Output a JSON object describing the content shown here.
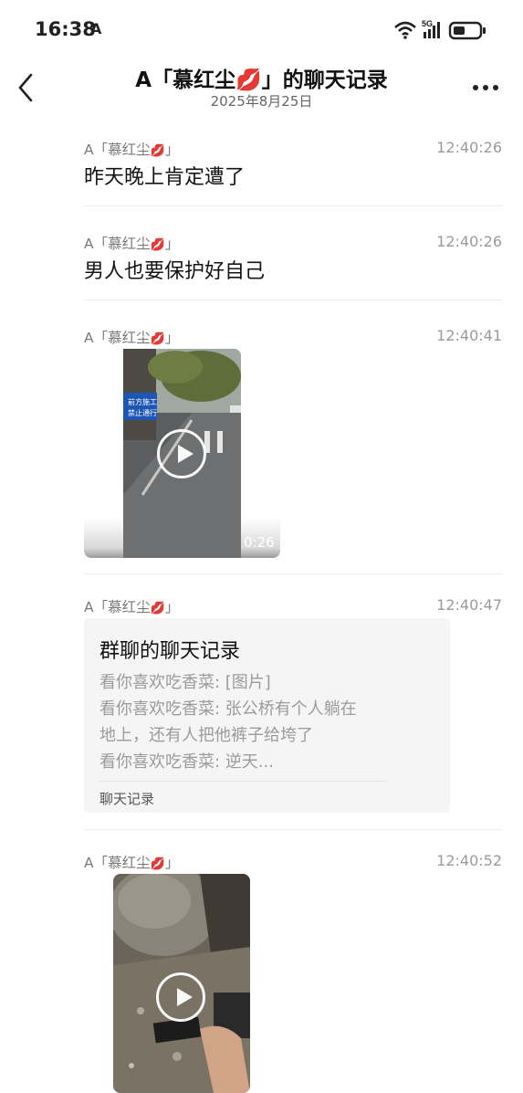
{
  "status": {
    "time": "16:38",
    "app_glyph": "A",
    "network": "5G"
  },
  "header": {
    "title": "A「慕红尘💋」的聊天记录",
    "date": "2025年8月25日"
  },
  "messages": [
    {
      "sender": "A「慕红尘",
      "emoji": "💋",
      "close": "」",
      "time": "12:40:26",
      "text": "昨天晚上肯定遭了"
    },
    {
      "sender": "A「慕红尘",
      "emoji": "💋",
      "close": "」",
      "time": "12:40:26",
      "text": "男人也要保护好自己"
    },
    {
      "sender": "A「慕红尘",
      "emoji": "💋",
      "close": "」",
      "time": "12:40:41",
      "video_duration": "0:26",
      "sign_line1": "前方施工",
      "sign_line2": "禁止通行"
    },
    {
      "sender": "A「慕红尘",
      "emoji": "💋",
      "close": "」",
      "time": "12:40:47",
      "card": {
        "title": "群聊的聊天记录",
        "lines": [
          "看你喜欢吃香菜: [图片]",
          "看你喜欢吃香菜: 张公桥有个人躺在",
          "地上，还有人把他裤子给垮了",
          "看你喜欢吃香菜: 逆天..."
        ],
        "footer": "聊天记录"
      }
    },
    {
      "sender": "A「慕红尘",
      "emoji": "💋",
      "close": "」",
      "time": "12:40:52"
    }
  ]
}
